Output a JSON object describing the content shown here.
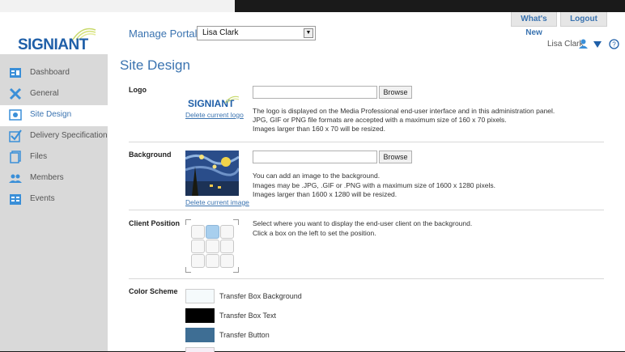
{
  "header": {
    "logo_text": "SIGNIANT",
    "manage_portal_label": "Manage Portal:",
    "portal_select_value": "Lisa Clark",
    "whats_new_tab": "What's New",
    "logout_tab": "Logout",
    "user_name": "Lisa Clark"
  },
  "sidebar": {
    "items": [
      {
        "label": "Dashboard",
        "icon": "dashboard-icon"
      },
      {
        "label": "General",
        "icon": "tools-icon"
      },
      {
        "label": "Site Design",
        "icon": "site-design-icon"
      },
      {
        "label": "Delivery Specification",
        "icon": "checkbox-icon"
      },
      {
        "label": "Files",
        "icon": "files-icon"
      },
      {
        "label": "Members",
        "icon": "members-icon"
      },
      {
        "label": "Events",
        "icon": "events-icon"
      }
    ],
    "active": "Site Design"
  },
  "main": {
    "title": "Site Design",
    "logo_section": {
      "label": "Logo",
      "preview_text": "SIGNIANT",
      "delete_link": "Delete current logo",
      "browse_label": "Browse",
      "desc": [
        "The logo is displayed on the Media Professional end-user interface and in this administration panel.",
        "JPG, GIF or PNG file formats are accepted with a maximum size of 160 x 70 pixels.",
        "Images larger than 160 x 70 will be resized."
      ]
    },
    "background_section": {
      "label": "Background",
      "delete_link": "Delete current image",
      "browse_label": "Browse",
      "desc": [
        "You can add an image to the background.",
        "Images may be .JPG, .GIF or .PNG with a maximum size of 1600 x 1280 pixels.",
        "Images larger than 1600 x 1280 will be resized."
      ]
    },
    "client_position": {
      "label": "Client Position",
      "desc": [
        "Select where you want to display the end-user client on the background.",
        "Click a box on the left to set the position."
      ]
    },
    "color_scheme": {
      "label": "Color Scheme",
      "swatches": [
        {
          "label": "Transfer Box Background",
          "color": "#f5fafc"
        },
        {
          "label": "Transfer Box Text",
          "color": "#000000"
        },
        {
          "label": "Transfer Button",
          "color": "#3e6e94"
        }
      ]
    }
  },
  "colors": {
    "accent": "#3a73b0",
    "sidebar_bg": "#d9d9d9"
  }
}
